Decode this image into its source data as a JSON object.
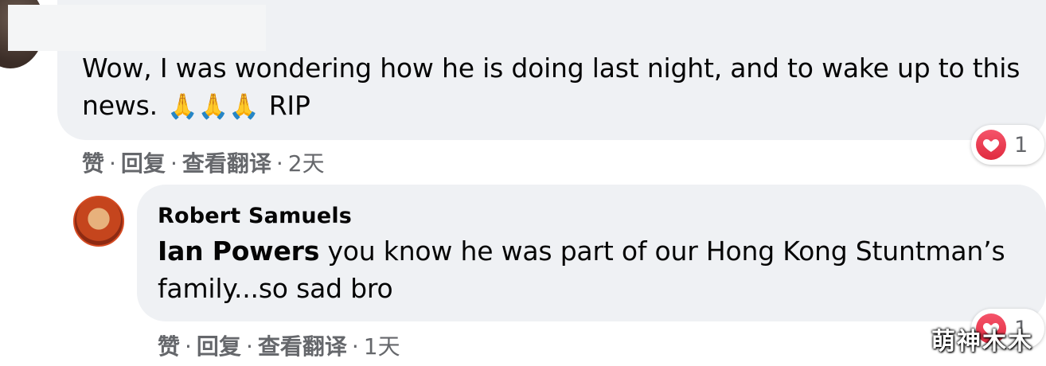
{
  "comments": [
    {
      "text_before_emoji": "Wow, I was wondering how he is doing last night, and to wake up to this news.",
      "emoji": "🙏🙏🙏",
      "text_after_emoji": "RIP",
      "actions": {
        "like": "赞",
        "reply": "回复",
        "translate": "查看翻译",
        "time": "2天"
      },
      "reaction_count": "1"
    },
    {
      "author": "Robert Samuels",
      "mention": "Ian Powers",
      "text": "you know he was part of our Hong Kong Stuntman’s family...so sad bro",
      "actions": {
        "like": "赞",
        "reply": "回复",
        "translate": "查看翻译",
        "time": "1天"
      },
      "reaction_count": "1"
    }
  ],
  "separator": "·",
  "reaction_icon": "heart-icon",
  "colors": {
    "bubble": "#eff1f4",
    "meta_text": "#65676b",
    "heart": "#e02a3f"
  },
  "watermark": "萌神木木"
}
